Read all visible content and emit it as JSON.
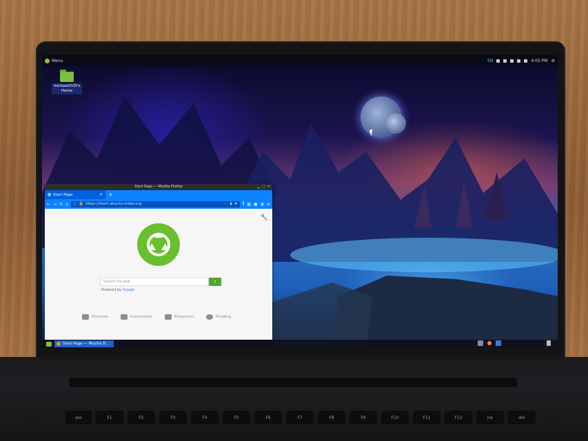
{
  "topbar": {
    "menu_label": "Menu",
    "keyboard_layout": "EN",
    "clock": "4:05 PM"
  },
  "desktop": {
    "home_icon_label": "michael315f's Home"
  },
  "firefox": {
    "window_title": "Start Page — Mozilla Firefox",
    "tab_title": "Start Page",
    "url": "https://start.ubuntu-mate.org",
    "search_placeholder": "Search the web",
    "powered_by": "Powered by",
    "powered_brand": "Google",
    "links": [
      "Discover",
      "Community",
      "Emporium",
      "Funding"
    ]
  },
  "taskbar": {
    "task_label": "Start Page — Mozilla Fi..."
  },
  "keyboard_row": [
    "esc",
    "F1",
    "F2",
    "F3",
    "F4",
    "F5",
    "F6",
    "F7",
    "F8",
    "F9",
    "F10",
    "F11",
    "F12",
    "ins",
    "del"
  ],
  "colors": {
    "firefox_blue": "#0a84ff",
    "mate_green": "#6abf2e",
    "search_button": "#4ca82a"
  }
}
